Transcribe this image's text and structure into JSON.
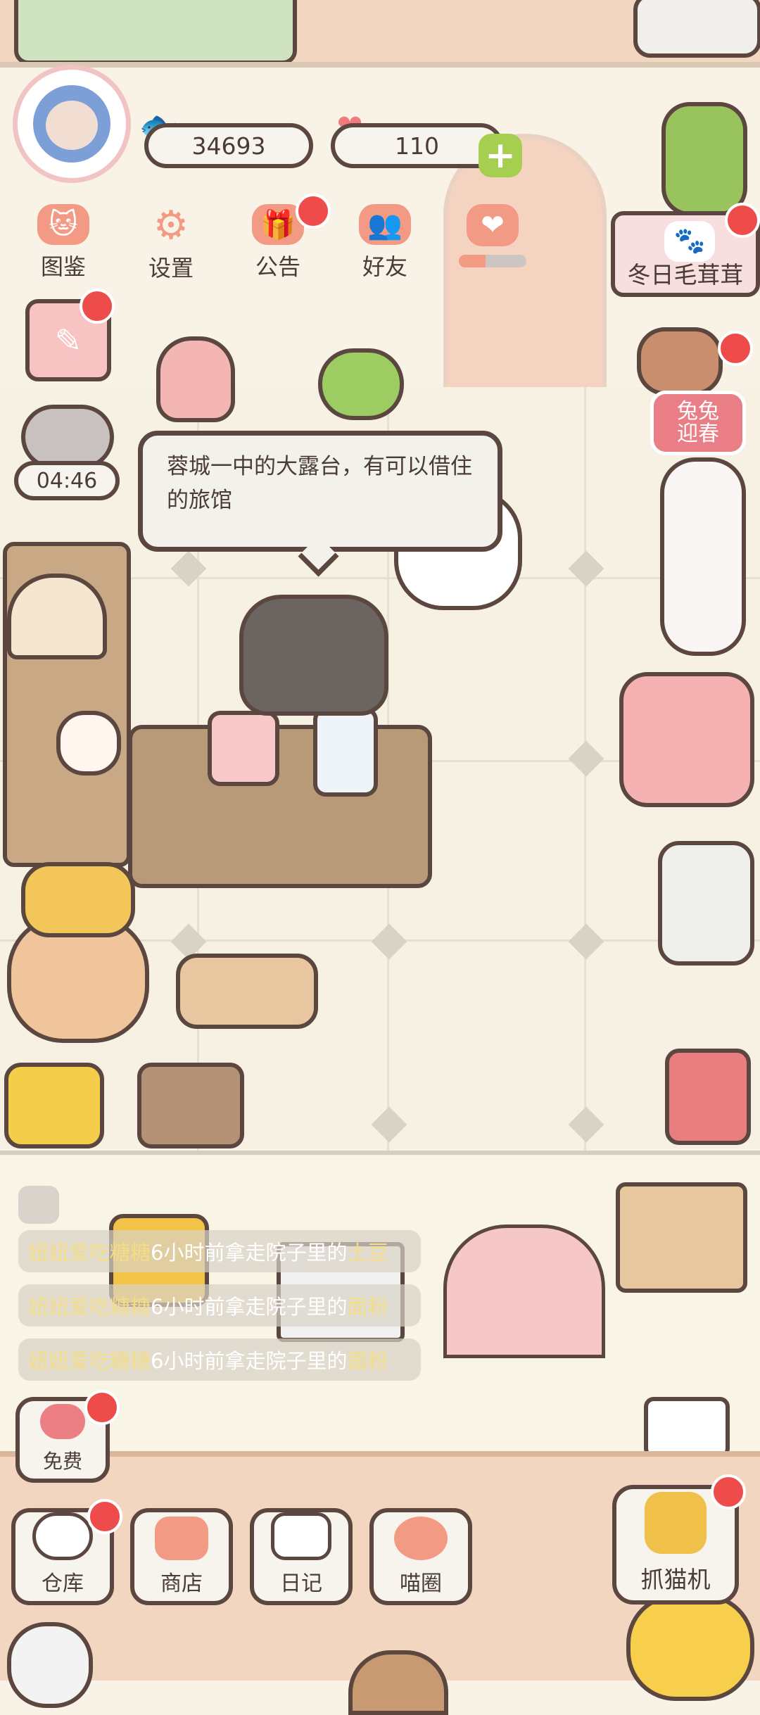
{
  "stats": {
    "coins": "34693",
    "hearts": "110"
  },
  "top_menu": [
    {
      "label": "图鉴"
    },
    {
      "label": "设置"
    },
    {
      "label": "公告"
    },
    {
      "label": "好友"
    }
  ],
  "events": {
    "banner_label": "冬日毛茸茸",
    "badge_label_line1": "兔兔",
    "badge_label_line2": "迎春"
  },
  "timer": "04:46",
  "speech_bubble": "蓉城一中的大露台，有可以借住的旅馆",
  "activity_log": [
    {
      "name": "妞妞爱吃糖糖",
      "action": "6小时前拿走院子里的",
      "item": "土豆"
    },
    {
      "name": "妞妞爱吃糖糖",
      "action": "6小时前拿走院子里的",
      "item": "面粉"
    },
    {
      "name": "妞妞爱吃糖糖",
      "action": "6小时前拿走院子里的",
      "item": "面粉"
    }
  ],
  "free_button": "免费",
  "bottom_nav": [
    {
      "label": "仓库"
    },
    {
      "label": "商店"
    },
    {
      "label": "日记"
    },
    {
      "label": "喵圈"
    }
  ],
  "claw_machine": "抓猫机",
  "colors": {
    "outline": "#5b4740",
    "badge_red": "#ee4b4b",
    "floor": "#f6f1e2",
    "wall": "#f3d6bf",
    "log_highlight": "#f3dd86"
  }
}
